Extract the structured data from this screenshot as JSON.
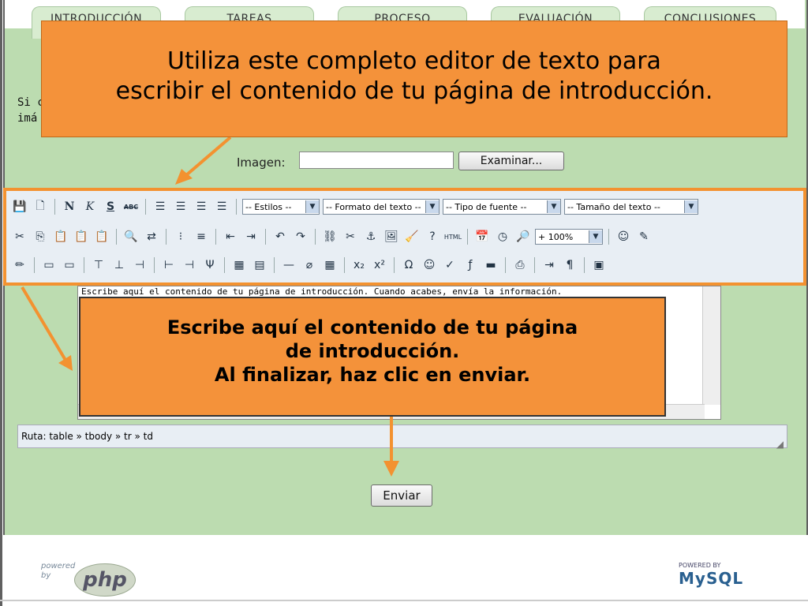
{
  "tabs": [
    "INTRODUCCIÓN",
    "TAREAS",
    "PROCESO",
    "EVALUACIÓN",
    "CONCLUSIONES"
  ],
  "intro_text_partial": [
    "Si c",
    "imá"
  ],
  "imagen": {
    "label": "Imagen:",
    "button": "Examinar..."
  },
  "toolbar": {
    "row1_buttons": [
      "N",
      "K",
      "S",
      "ABC"
    ],
    "selects": [
      "-- Estilos --",
      "-- Formato del texto --",
      "-- Tipo de fuente --",
      "-- Tamaño del texto --"
    ],
    "zoom": "+ 100%"
  },
  "editor": {
    "content": "Escribe aquí el contenido de tu página de introducción. Cuando acabes, envía la información."
  },
  "path_bar": "Ruta: table » tbody » tr » td",
  "submit": "Enviar",
  "callouts": {
    "top": [
      "Utiliza este completo editor de texto para",
      "escribir el contenido de tu página de introducción."
    ],
    "middle": [
      "Escribe aquí el contenido de tu página",
      "de introducción.",
      "Al finalizar, haz clic en enviar."
    ]
  },
  "footer": {
    "php_small": "powered by",
    "php_logo": "php",
    "mysql_small": "POWERED BY",
    "mysql_logo": "MySQL"
  },
  "colors": {
    "panel": "#bcdcb0",
    "callout": "#f4923a",
    "highlight": "#f39230"
  }
}
